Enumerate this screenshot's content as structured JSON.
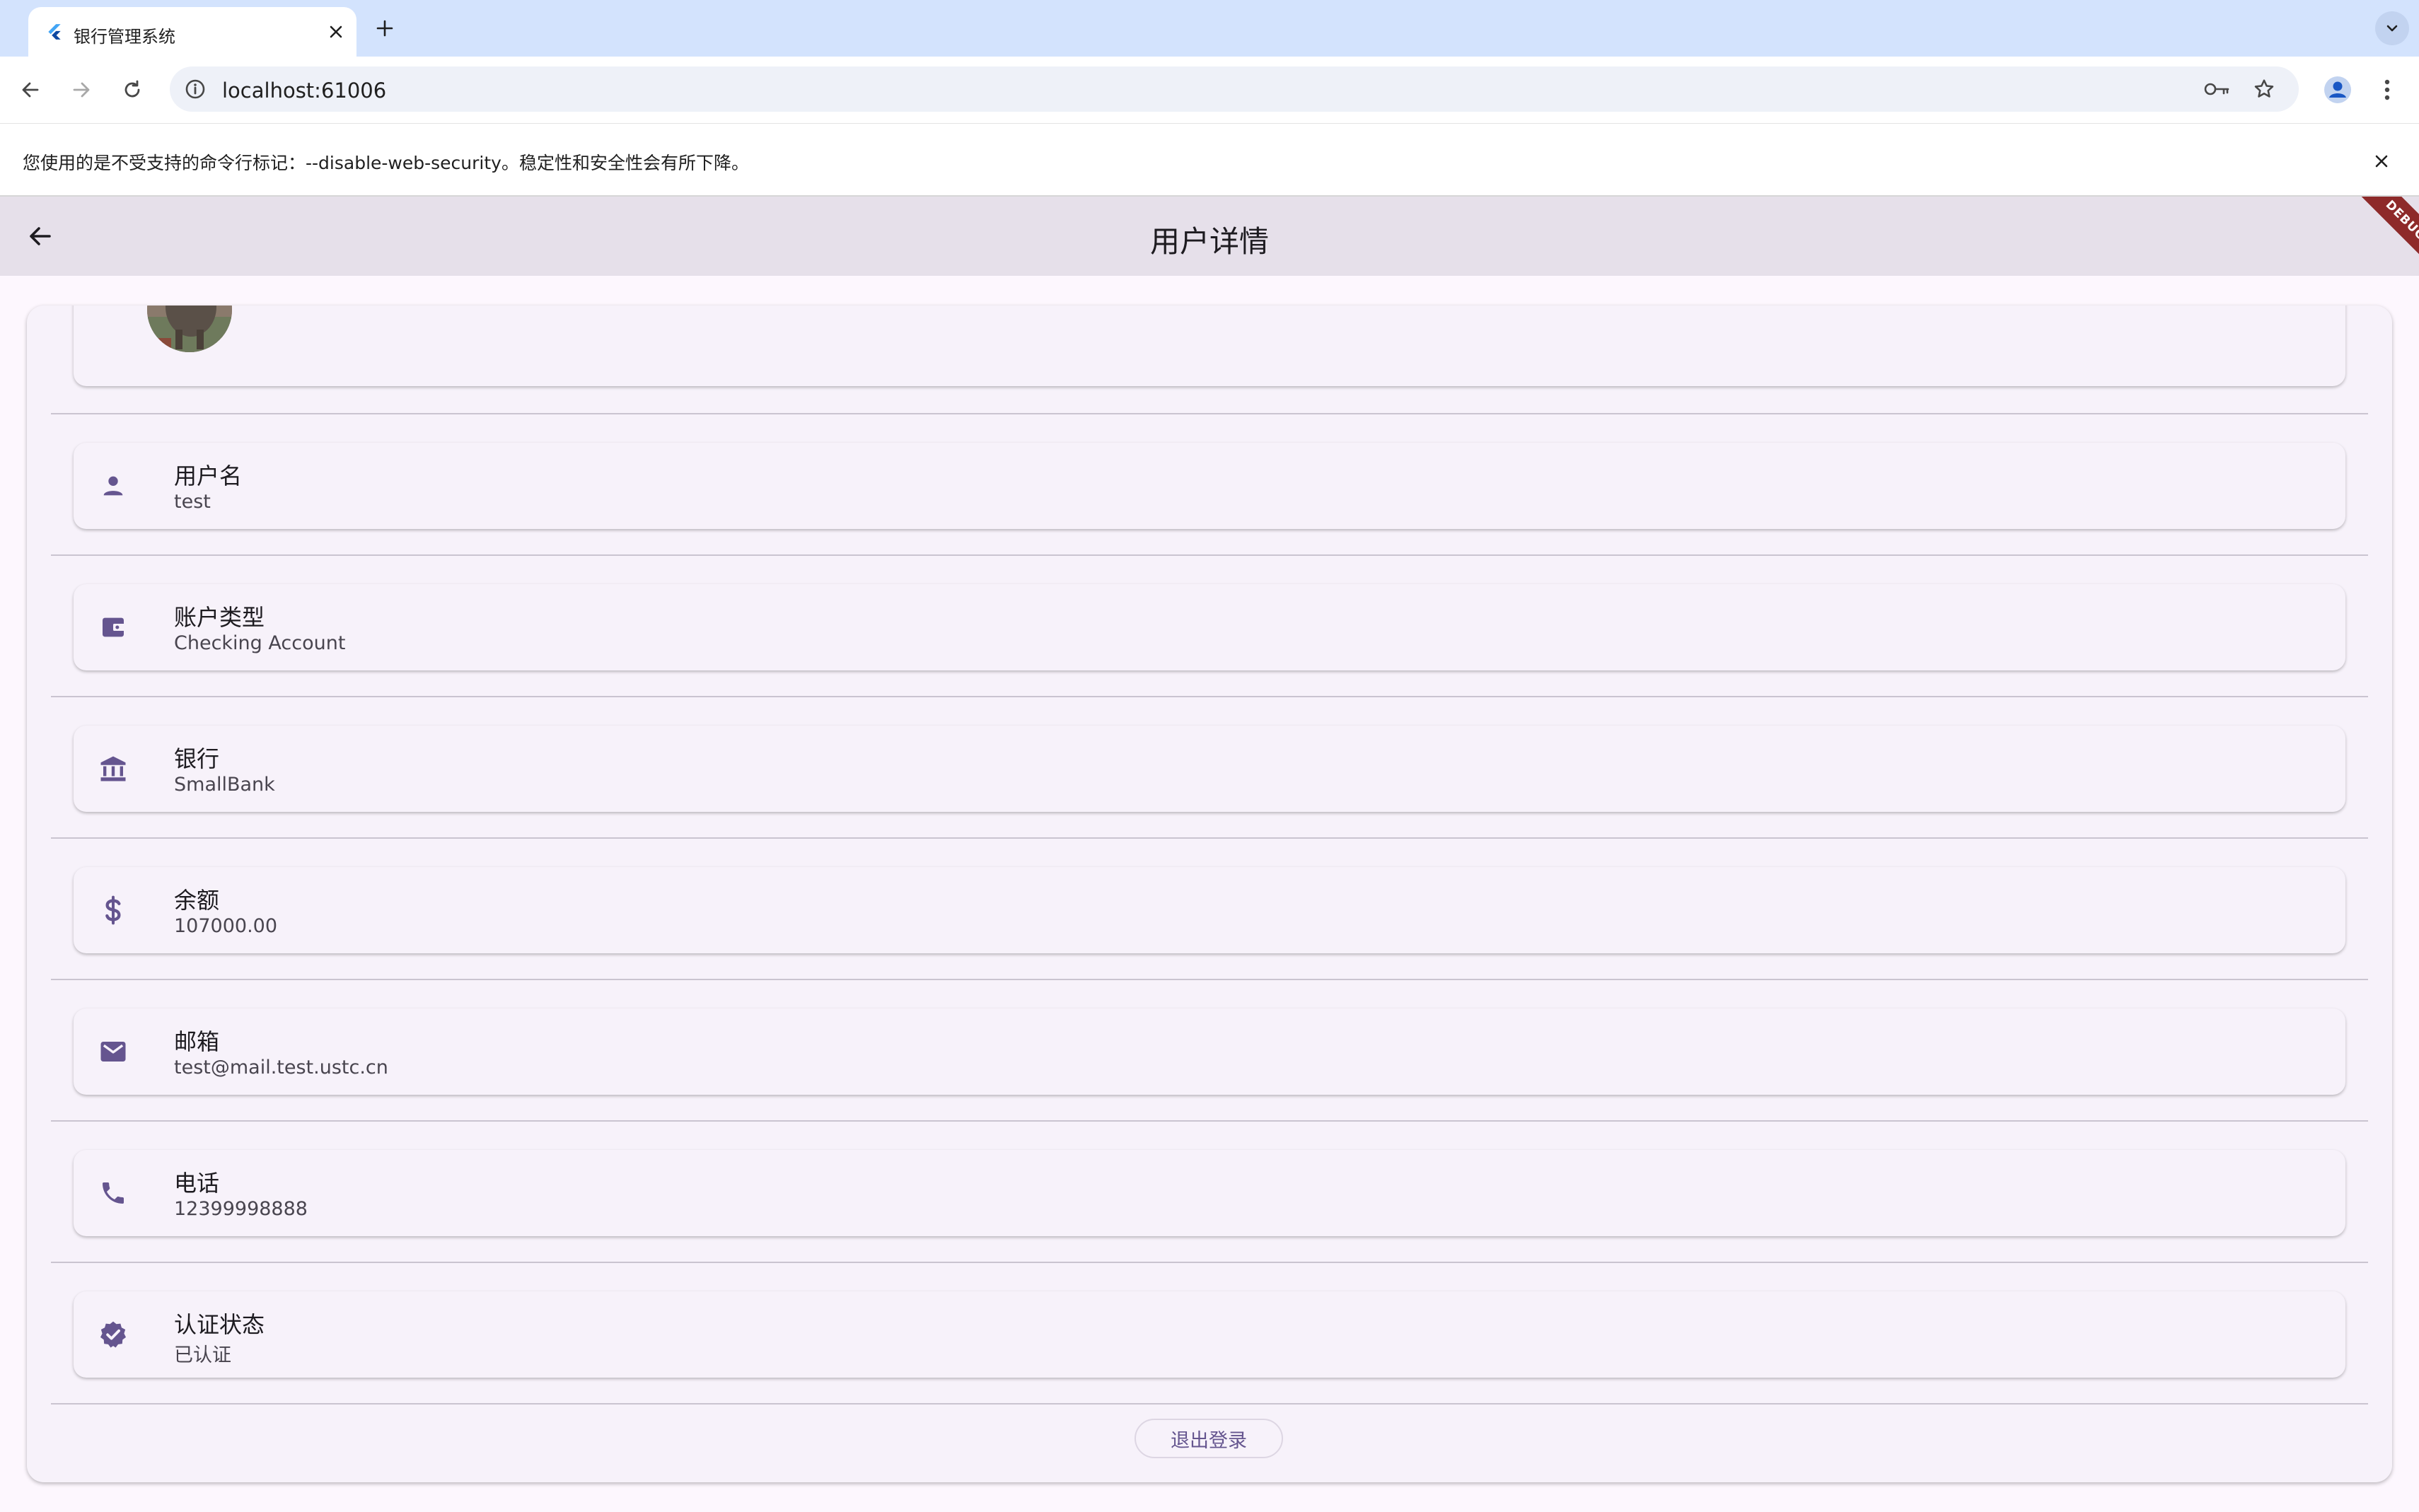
{
  "browser": {
    "tab_title": "银行管理系统",
    "url": "localhost:61006",
    "infobar_message": "您使用的是不受支持的命令行标记：--disable-web-security。稳定性和安全性会有所下降。"
  },
  "app": {
    "title": "用户详情",
    "debug_banner": "DEBUG",
    "accent_color": "#65558f",
    "items": [
      {
        "label": "用户名",
        "value": "test",
        "icon": "person-icon"
      },
      {
        "label": "账户类型",
        "value": "Checking Account",
        "icon": "wallet-icon"
      },
      {
        "label": "银行",
        "value": "SmallBank",
        "icon": "bank-icon"
      },
      {
        "label": "余额",
        "value": "107000.00",
        "icon": "dollar-icon"
      },
      {
        "label": "邮箱",
        "value": "test@mail.test.ustc.cn",
        "icon": "email-icon"
      },
      {
        "label": "电话",
        "value": "12399998888",
        "icon": "phone-icon"
      },
      {
        "label": "认证状态",
        "value": "已认证",
        "icon": "verified-icon"
      }
    ],
    "logout_label": "退出登录"
  }
}
